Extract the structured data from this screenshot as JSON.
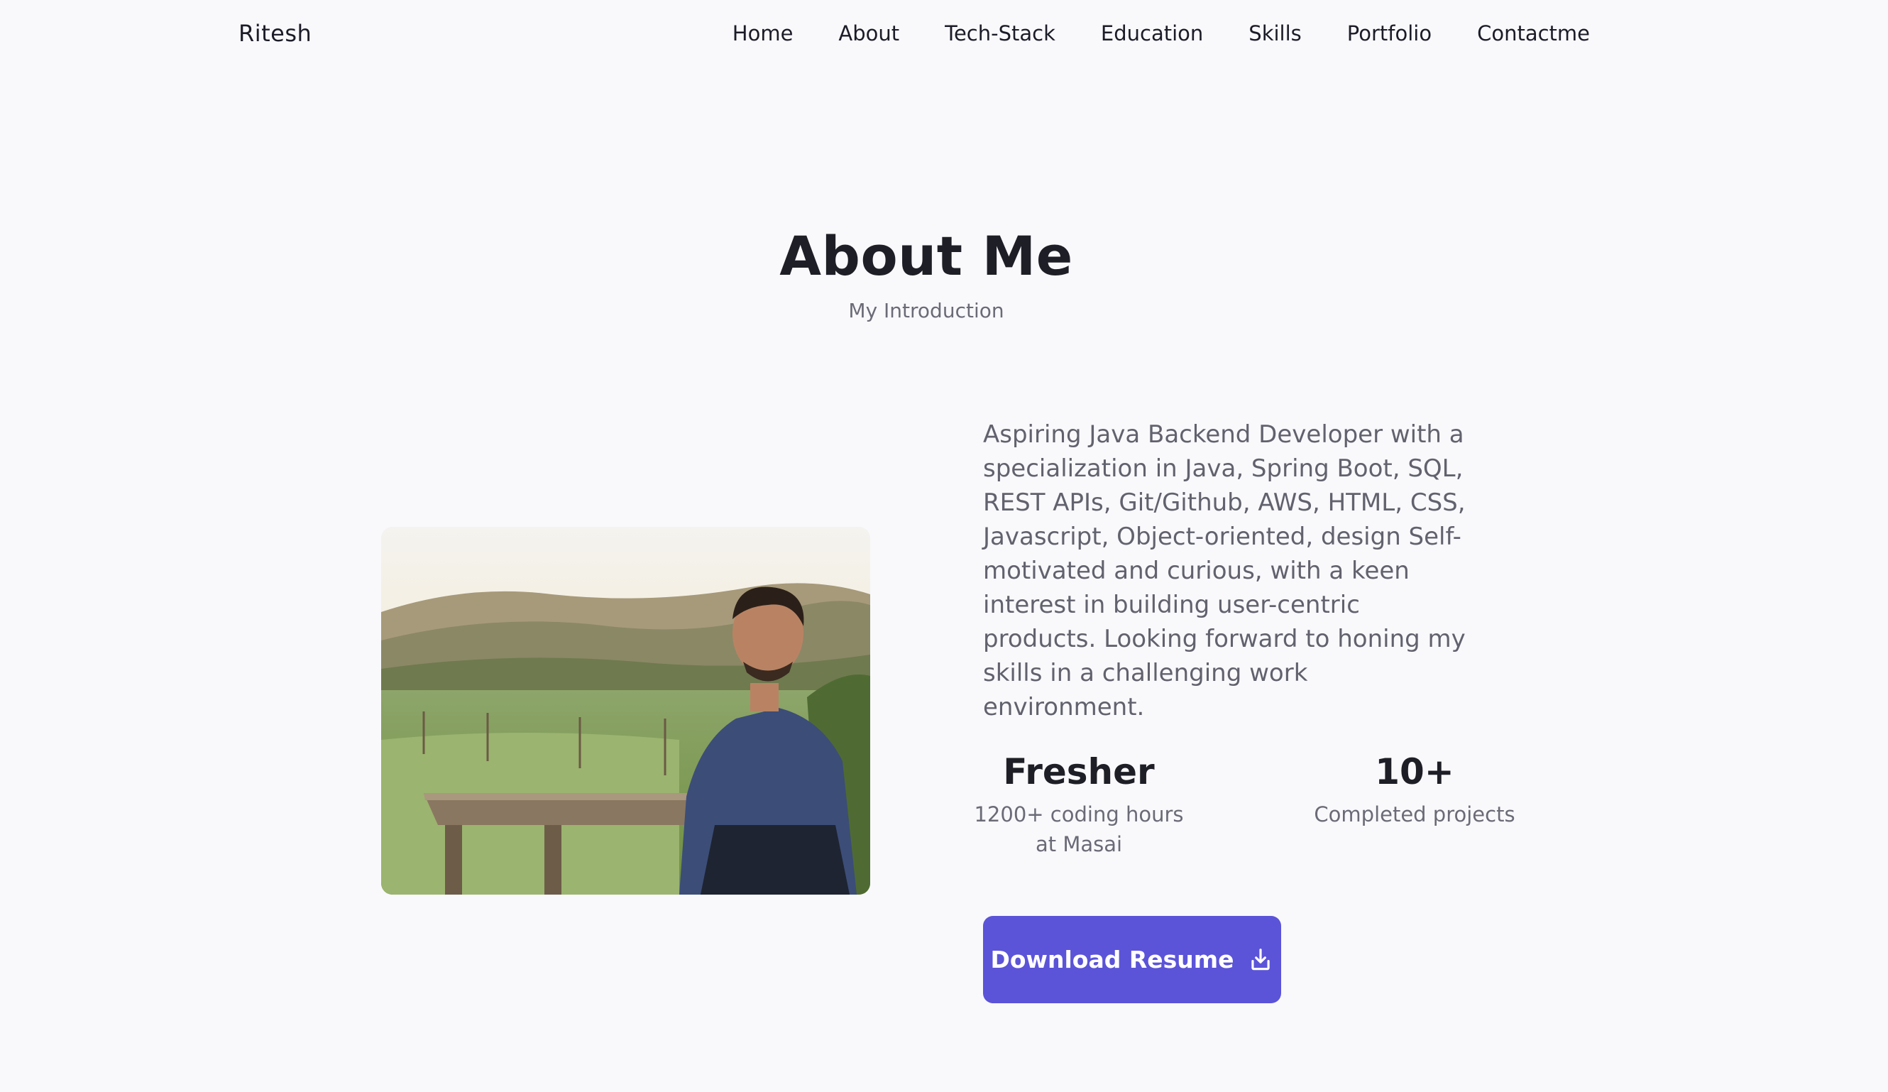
{
  "nav": {
    "brand": "Ritesh",
    "links": [
      "Home",
      "About",
      "Tech-Stack",
      "Education",
      "Skills",
      "Portfolio",
      "Contactme"
    ]
  },
  "about": {
    "title": "About Me",
    "subtitle": "My Introduction",
    "description": "Aspiring Java Backend Developer with a specialization in Java, Spring Boot, SQL, REST APIs, Git/Github, AWS, HTML, CSS, Javascript, Object-oriented, design Self-motivated and curious, with a keen interest in building user-centric products. Looking forward to honing my skills in a challenging work environment.",
    "stats": [
      {
        "value": "Fresher",
        "label": "1200+ coding hours at Masai"
      },
      {
        "value": "10+",
        "label": "Completed projects"
      }
    ],
    "download_label": "Download Resume"
  },
  "colors": {
    "accent": "#5b54d8",
    "background": "#f9f9fc"
  },
  "icons": {
    "download": "download-icon"
  }
}
